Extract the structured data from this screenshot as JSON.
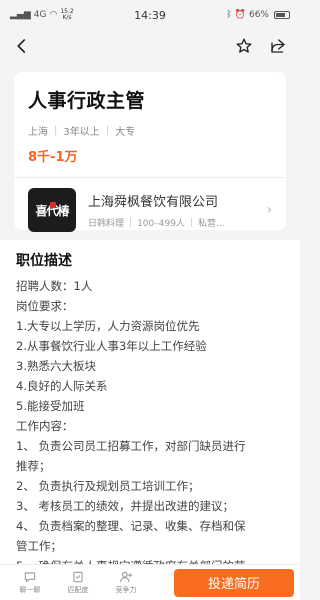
{
  "status_bar": {
    "signal": "4G",
    "net_speed_value": "15.2",
    "net_speed_unit": "K/s",
    "time": "14:39",
    "battery": "66%"
  },
  "nav": {
    "back_icon": "back-arrow-icon",
    "favorite_icon": "star-icon",
    "share_icon": "share-icon"
  },
  "job": {
    "title": "人事行政主管",
    "city": "上海",
    "experience": "3年以上",
    "education": "大专",
    "salary": "8千-1万"
  },
  "company": {
    "logo_text": "喜代椿",
    "name": "上海舜枫餐饮有限公司",
    "industry": "日韩料理",
    "size": "100–499人",
    "type": "私营..."
  },
  "description": {
    "title": "职位描述",
    "lines": [
      "招聘人数：1人",
      "岗位要求：",
      "1.大专以上学历，人力资源岗位优先",
      "2.从事餐饮行业人事3年以上工作经验",
      "3.熟悉六大板块",
      "4.良好的人际关系",
      "5.能接受加班",
      "工作内容：",
      "1、 负责公司员工招募工作，对部门缺员进行",
      "推荐；",
      "2、 负责执行及规划员工培训工作；",
      "3、 考核员工的绩效，并提出改进的建议；",
      "4、 负责档案的整理、记录、收集、存档和保",
      "管工作；",
      "5、 确保有关人事规定遵循政府有关部门的劳"
    ]
  },
  "bottom_bar": {
    "chat_label": "聊一聊",
    "match_label": "匹配度",
    "compete_label": "竞争力",
    "apply_label": "投递简历"
  },
  "colors": {
    "accent": "#f96d20",
    "salary": "#f4651f"
  }
}
